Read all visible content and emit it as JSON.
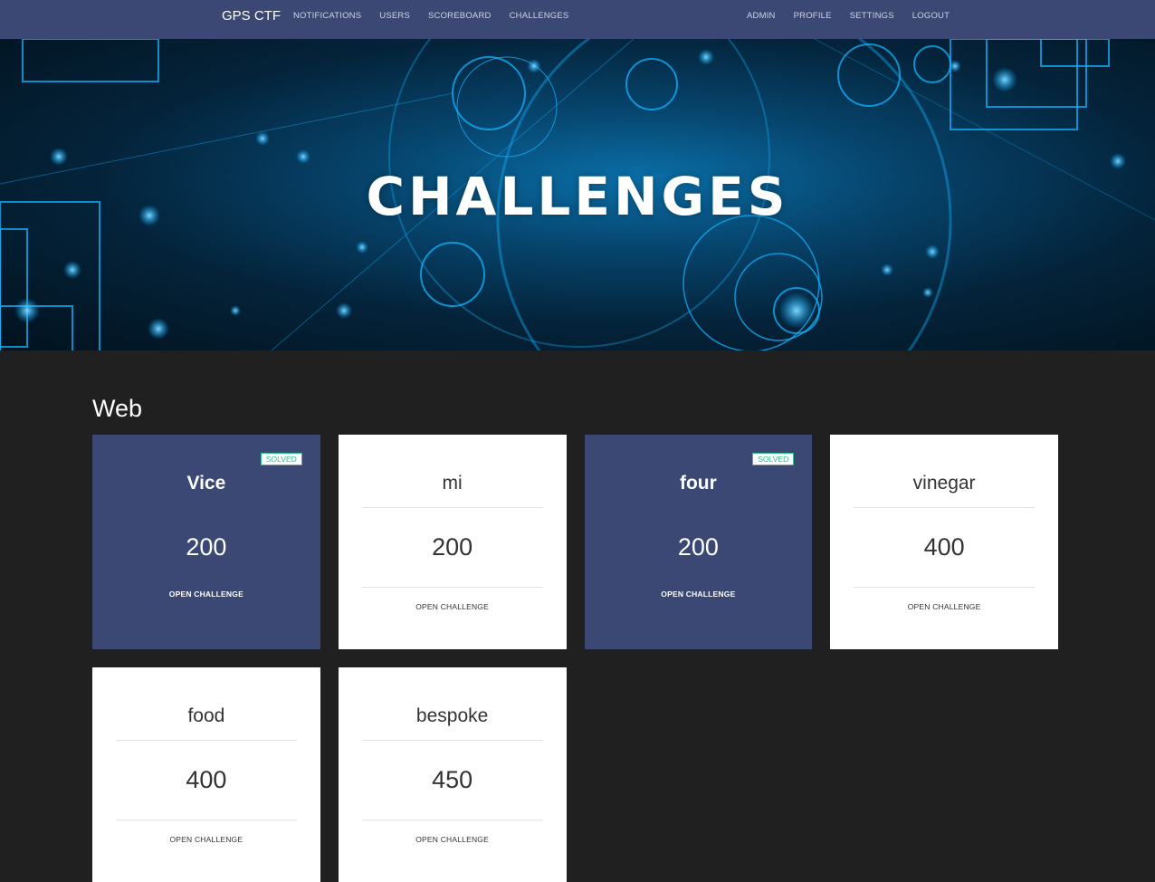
{
  "nav": {
    "brand": "GPS CTF",
    "left": [
      "NOTIFICATIONS",
      "USERS",
      "SCOREBOARD",
      "CHALLENGES"
    ],
    "right": [
      "ADMIN",
      "PROFILE",
      "SETTINGS",
      "LOGOUT"
    ]
  },
  "hero": {
    "title": "CHALLENGES"
  },
  "category": {
    "name": "Web"
  },
  "challenges": [
    {
      "name": "Vice",
      "value": "200",
      "solved": true,
      "badge": "SOLVED",
      "action": "OPEN CHALLENGE"
    },
    {
      "name": "mi",
      "value": "200",
      "solved": false,
      "badge": "",
      "action": "OPEN CHALLENGE"
    },
    {
      "name": "four",
      "value": "200",
      "solved": true,
      "badge": "SOLVED",
      "action": "OPEN CHALLENGE"
    },
    {
      "name": "vinegar",
      "value": "400",
      "solved": false,
      "badge": "",
      "action": "OPEN CHALLENGE"
    },
    {
      "name": "food",
      "value": "400",
      "solved": false,
      "badge": "",
      "action": "OPEN CHALLENGE"
    },
    {
      "name": "bespoke",
      "value": "450",
      "solved": false,
      "badge": "",
      "action": "OPEN CHALLENGE"
    }
  ],
  "colors": {
    "navbar": "#3c4874",
    "background": "#202020",
    "solved_card": "#3c4874",
    "badge_text": "#2fbf88"
  }
}
